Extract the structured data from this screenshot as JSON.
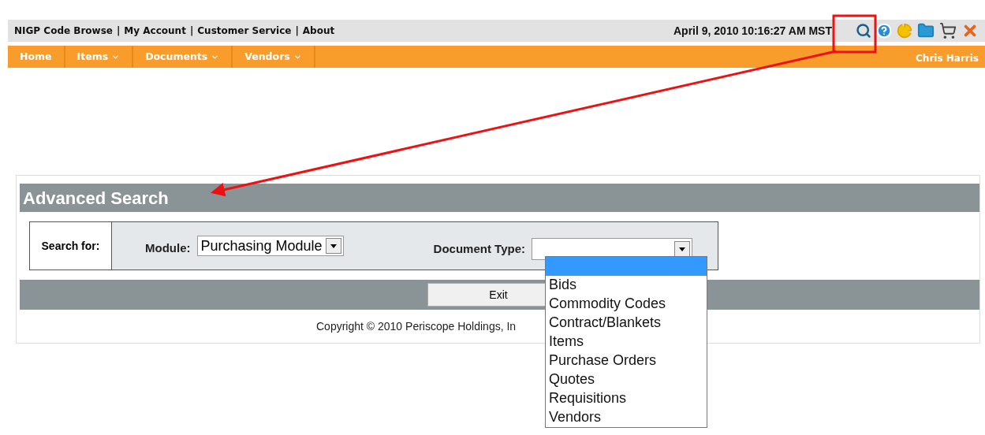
{
  "top_links": [
    "NIGP Code Browse",
    "My Account",
    "Customer Service",
    "About"
  ],
  "top_links_separator": "|",
  "datetime": "April 9, 2010 10:16:27 AM MST",
  "nav": [
    {
      "label": "Home",
      "has_menu": false
    },
    {
      "label": "Items",
      "has_menu": true
    },
    {
      "label": "Documents",
      "has_menu": true
    },
    {
      "label": "Vendors",
      "has_menu": true
    }
  ],
  "user": "Chris Harris",
  "panel": {
    "title": "Advanced Search",
    "search_for": "Search for:",
    "module_label": "Module:",
    "module_value": "Purchasing Module",
    "doctype_label": "Document Type:",
    "exit": "Exit",
    "copyright": "Copyright © 2010 Periscope Holdings, In"
  },
  "doctype_options": [
    {
      "selected": true
    },
    {
      "label": "Bids",
      "selected": false
    },
    {
      "label": "Commodity Codes",
      "selected": false
    },
    {
      "label": "Contract/Blankets",
      "selected": false
    },
    {
      "label": "Items",
      "selected": false
    },
    {
      "label": "Purchase Orders",
      "selected": false
    },
    {
      "label": "Quotes",
      "selected": false
    },
    {
      "label": "Requisitions",
      "selected": false
    },
    {
      "label": "Vendors",
      "selected": false
    }
  ]
}
